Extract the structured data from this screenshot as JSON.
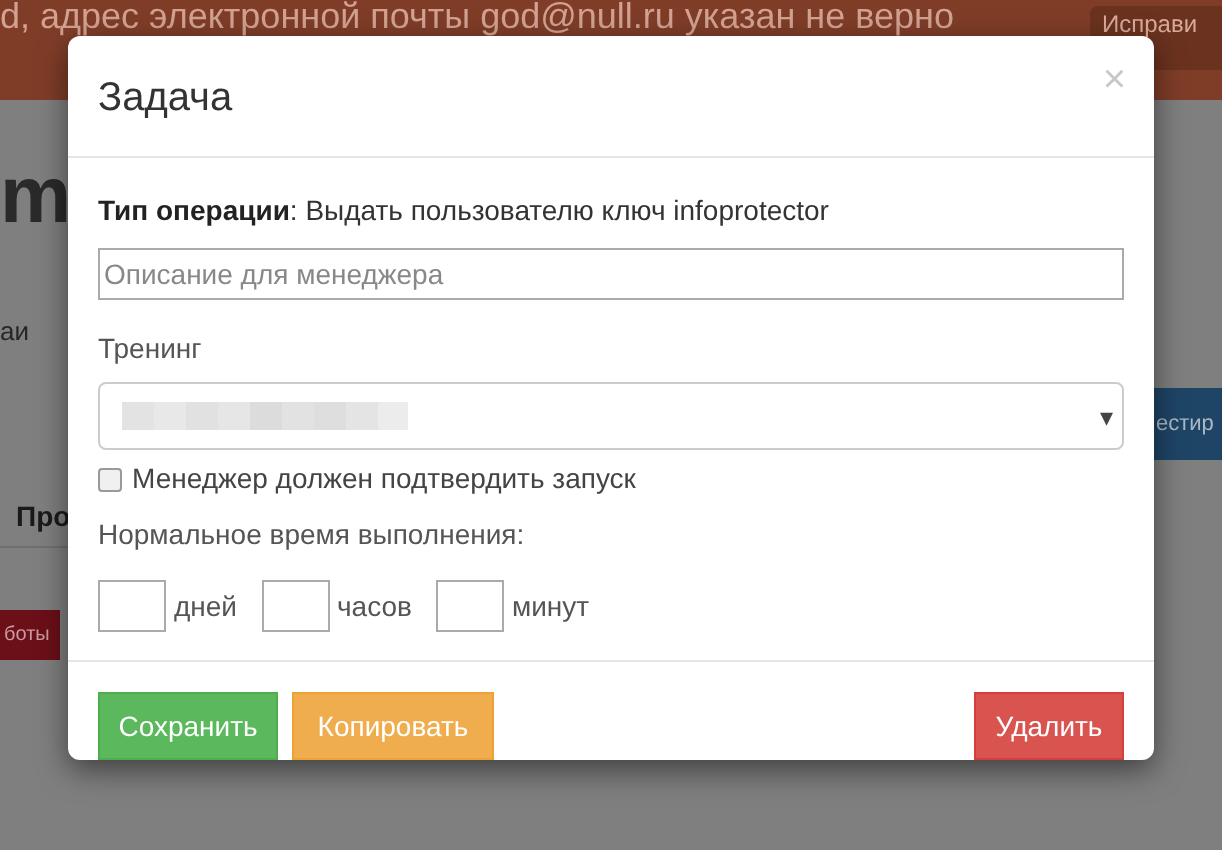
{
  "background": {
    "banner": {
      "message": "d, адрес электронной почты god@null.ru указан не верно",
      "button": "Исправи"
    },
    "heading": "m",
    "side_text": "аи",
    "tab": "Про",
    "red_button": "боты",
    "blue_button": "естир"
  },
  "modal": {
    "title": "Задача",
    "close": "×",
    "operation": "**Тип операции**: Выдать пользователю ключ infoprotector",
    "description": {
      "placeholder": "Описание для менеджера"
    },
    "training": {
      "label": "Тренинг",
      "arrow": "▾"
    },
    "confirm": {
      "label": "Менеджер должен подтвердить запуск",
      "checked": false
    },
    "time_label": "Нормальное время выполнения:",
    "duration": [
      {
        "unit": "дней"
      },
      {
        "unit": "часов"
      },
      {
        "unit": "минут"
      }
    ],
    "buttons": [
      {
        "label": "Сохранить",
        "kind": "success"
      },
      {
        "label": "Копировать",
        "kind": "warning"
      },
      {
        "label": "Удалить",
        "kind": "danger"
      }
    ]
  }
}
